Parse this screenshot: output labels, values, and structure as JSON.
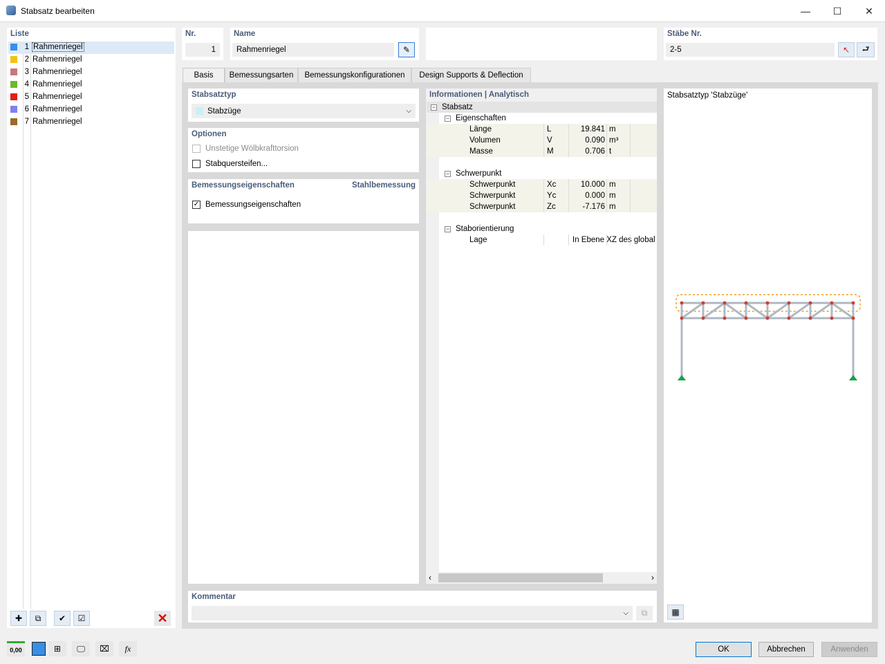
{
  "window": {
    "title": "Stabsatz bearbeiten",
    "minimize": "—",
    "maximize": "☐",
    "close": "✕"
  },
  "list": {
    "header": "Liste",
    "items": [
      {
        "num": "1",
        "label": "Rahmenriegel",
        "color": "#3a8ee6"
      },
      {
        "num": "2",
        "label": "Rahmenriegel",
        "color": "#f4c20d"
      },
      {
        "num": "3",
        "label": "Rahmenriegel",
        "color": "#c87878"
      },
      {
        "num": "4",
        "label": "Rahmenriegel",
        "color": "#6fb82a"
      },
      {
        "num": "5",
        "label": "Rahmenriegel",
        "color": "#e11d1d"
      },
      {
        "num": "6",
        "label": "Rahmenriegel",
        "color": "#8080f0"
      },
      {
        "num": "7",
        "label": "Rahmenriegel",
        "color": "#9a6a28"
      }
    ]
  },
  "nr": {
    "label": "Nr.",
    "value": "1"
  },
  "name": {
    "label": "Name",
    "value": "Rahmenriegel"
  },
  "members": {
    "label": "Stäbe Nr.",
    "value": "2-5"
  },
  "tabs": [
    "Basis",
    "Bemessungsarten",
    "Bemessungskonfigurationen",
    "Design Supports & Deflection"
  ],
  "stabsatztyp": {
    "label": "Stabsatztyp",
    "value": "Stabzüge"
  },
  "optionen": {
    "label": "Optionen",
    "opt1": "Unstetige Wölbkrafttorsion",
    "opt2": "Stabquersteifen..."
  },
  "bemessung": {
    "label": "Bemessungseigenschaften",
    "right": "Stahlbemessung",
    "check": "Bemessungseigenschaften"
  },
  "info": {
    "header": "Informationen | Analytisch",
    "root": "Stabsatz",
    "g1": "Eigenschaften",
    "g1rows": [
      {
        "label": "Länge",
        "sym": "L",
        "val": "19.841",
        "unit": "m"
      },
      {
        "label": "Volumen",
        "sym": "V",
        "val": "0.090",
        "unit": "m³"
      },
      {
        "label": "Masse",
        "sym": "M",
        "val": "0.706",
        "unit": "t"
      }
    ],
    "g2": "Schwerpunkt",
    "g2rows": [
      {
        "label": "Schwerpunkt",
        "sym": "Xc",
        "val": "10.000",
        "unit": "m"
      },
      {
        "label": "Schwerpunkt",
        "sym": "Yc",
        "val": "0.000",
        "unit": "m"
      },
      {
        "label": "Schwerpunkt",
        "sym": "Zc",
        "val": "-7.176",
        "unit": "m"
      }
    ],
    "g3": "Staborientierung",
    "g3rows": [
      {
        "label": "Lage",
        "sym": "",
        "val": "In Ebene XZ des globale",
        "unit": ""
      }
    ]
  },
  "preview": {
    "title": "Stabsatztyp 'Stabzüge'"
  },
  "kommentar": {
    "label": "Kommentar"
  },
  "buttons": {
    "ok": "OK",
    "cancel": "Abbrechen",
    "apply": "Anwenden"
  },
  "bottom_tool": {
    "units": "0,00"
  },
  "colors": {
    "accent": "#3a8ee6",
    "header_text": "#4a5c7a"
  }
}
